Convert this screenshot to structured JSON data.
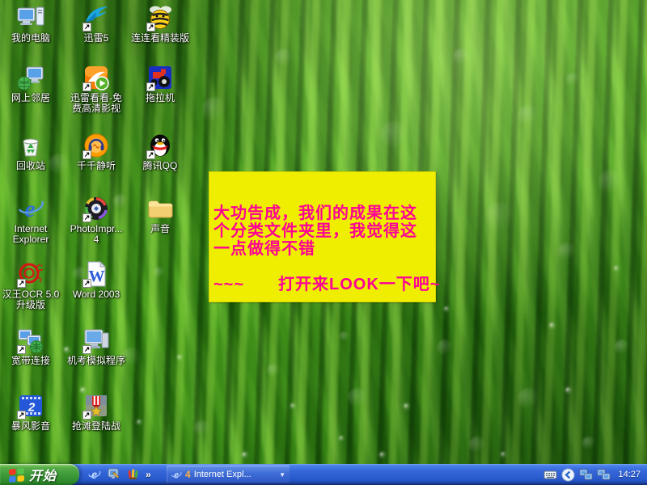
{
  "desktop_icons": [
    {
      "id": "my-computer",
      "glyph": "computer",
      "shortcut": false,
      "label_lines": [
        "我的电脑"
      ]
    },
    {
      "id": "thunder-5",
      "glyph": "thunder",
      "shortcut": true,
      "label_lines": [
        "迅雷5"
      ]
    },
    {
      "id": "lianliankan",
      "glyph": "bee",
      "shortcut": true,
      "label_lines": [
        "连连看精装版"
      ]
    },
    {
      "id": "network-places",
      "glyph": "network",
      "shortcut": false,
      "label_lines": [
        "网上邻居"
      ]
    },
    {
      "id": "xunlei-kankan",
      "glyph": "kankan",
      "shortcut": true,
      "label_lines": [
        "迅雷看看-免",
        "费高清影视"
      ]
    },
    {
      "id": "tractor-game",
      "glyph": "tractor",
      "shortcut": true,
      "label_lines": [
        "拖拉机"
      ]
    },
    {
      "id": "recycle-bin",
      "glyph": "recycle",
      "shortcut": false,
      "label_lines": [
        "回收站"
      ]
    },
    {
      "id": "ttplayer",
      "glyph": "ttplayer",
      "shortcut": true,
      "label_lines": [
        "千千静听"
      ]
    },
    {
      "id": "tencent-qq",
      "glyph": "qq",
      "shortcut": true,
      "label_lines": [
        "腾讯QQ"
      ]
    },
    {
      "id": "internet-explorer",
      "glyph": "ie",
      "shortcut": false,
      "label_lines": [
        "Internet",
        "Explorer"
      ]
    },
    {
      "id": "photoimpression",
      "glyph": "photo",
      "shortcut": true,
      "label_lines": [
        "PhotoImpr...",
        "4"
      ]
    },
    {
      "id": "sound-folder",
      "glyph": "folder",
      "shortcut": false,
      "label_lines": [
        "声音"
      ]
    },
    {
      "id": "hanwang-ocr",
      "glyph": "ocr",
      "shortcut": true,
      "label_lines": [
        "汉王OCR 5.0",
        "升级版"
      ]
    },
    {
      "id": "word-2003",
      "glyph": "word",
      "shortcut": true,
      "label_lines": [
        "Word 2003"
      ]
    },
    {
      "id": "broadband",
      "glyph": "broadband",
      "shortcut": true,
      "label_lines": [
        "宽带连接"
      ]
    },
    {
      "id": "exam-simulator",
      "glyph": "examcomputer",
      "shortcut": true,
      "label_lines": [
        "机考模拟程序"
      ]
    },
    {
      "id": "storm-player",
      "glyph": "storm",
      "shortcut": true,
      "label_lines": [
        "暴风影音"
      ]
    },
    {
      "id": "beach-assault",
      "glyph": "medal",
      "shortcut": true,
      "label_lines": [
        "抢滩登陆战"
      ]
    }
  ],
  "note": {
    "bg_color": "#efee00",
    "text_color": "#ff0096",
    "lines": [
      "大功告成，我们的成果在这",
      "个分类文件夹里，我觉得这",
      "一点做得不错",
      "",
      "~~~　　打开来LOOK一下吧~"
    ]
  },
  "taskbar": {
    "start_label": "开始",
    "overflow_chevron": "»",
    "window_button": {
      "count": "4",
      "title": "Internet Expl...",
      "dropdown": "▼"
    },
    "clock": "14:27"
  },
  "colors": {
    "taskbar_blue": "#2c5ed2",
    "start_green": "#3b9838",
    "note_bg": "#efee00",
    "note_text": "#ff0096"
  }
}
